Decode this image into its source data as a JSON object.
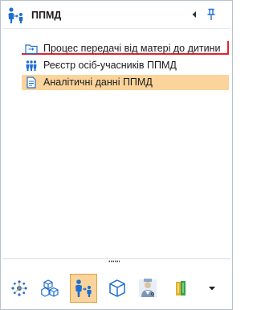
{
  "panel": {
    "title": "ППМД",
    "header_icon": "people-group-icon",
    "collapse_icon": "collapse-left-icon",
    "pin_icon": "pin-icon"
  },
  "tree": {
    "items": [
      {
        "label": "Процес передачі від матері до дитини",
        "icon": "folder-process-icon",
        "highlighted": true
      },
      {
        "label": "Реєстр осіб-учасників ППМД",
        "icon": "people-registry-icon",
        "selected": false
      },
      {
        "label": "Аналітичні данні ППМД",
        "icon": "document-icon",
        "selected": true
      }
    ]
  },
  "toolbar": {
    "buttons": [
      {
        "name": "network-icon",
        "active": false
      },
      {
        "name": "cubes-icon",
        "active": false
      },
      {
        "name": "parent-child-icon",
        "active": true
      },
      {
        "name": "cube-icon",
        "active": false
      },
      {
        "name": "doctor-icon",
        "active": false
      },
      {
        "name": "books-icon",
        "active": false
      }
    ],
    "overflow_icon": "dropdown-arrow-icon"
  },
  "colors": {
    "selected_bg": "#fbd49b",
    "highlight_border": "#e5212b",
    "icon_blue": "#1f6fd0"
  }
}
